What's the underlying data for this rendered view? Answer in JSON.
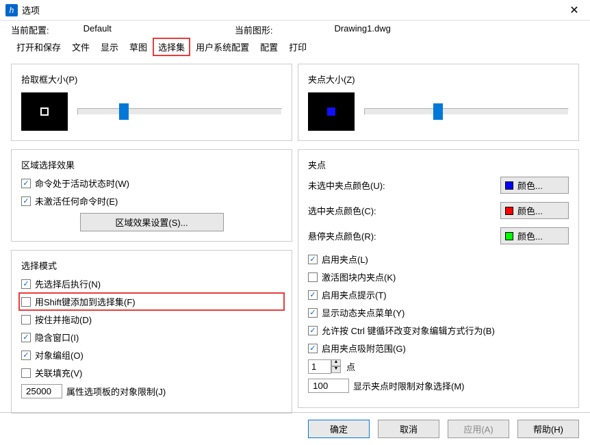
{
  "titlebar": {
    "title": "选项"
  },
  "info": {
    "config_label": "当前配置:",
    "config_value": "Default",
    "drawing_label": "当前图形:",
    "drawing_value": "Drawing1.dwg"
  },
  "tabs": [
    "打开和保存",
    "文件",
    "显示",
    "草图",
    "选择集",
    "用户系统配置",
    "配置",
    "打印"
  ],
  "pickbox": {
    "label": "拾取框大小(P)"
  },
  "gripsize": {
    "label": "夹点大小(Z)"
  },
  "region": {
    "label": "区域选择效果",
    "cb1": "命令处于活动状态时(W)",
    "cb2": "未激活任何命令时(E)",
    "btn": "区域效果设置(S)..."
  },
  "selmode": {
    "label": "选择模式",
    "cb1": "先选择后执行(N)",
    "cb2": "用Shift键添加到选择集(F)",
    "cb3": "按住并拖动(D)",
    "cb4": "隐含窗口(I)",
    "cb5": "对象编组(O)",
    "cb6": "关联填充(V)",
    "num": "25000",
    "num_label": "属性选项板的对象限制(J)"
  },
  "grips": {
    "label": "夹点",
    "row1": "未选中夹点颜色(U):",
    "row2": "选中夹点颜色(C):",
    "row3": "悬停夹点颜色(R):",
    "color_btn": "颜色...",
    "cb1": "启用夹点(L)",
    "cb2": "激活图块内夹点(K)",
    "cb3": "启用夹点提示(T)",
    "cb4": "显示动态夹点菜单(Y)",
    "cb5": "允许按 Ctrl 键循环改变对象编辑方式行为(B)",
    "cb6": "启用夹点吸附范围(G)",
    "spin": "1",
    "spin_label": "点",
    "num": "100",
    "num_label": "显示夹点时限制对象选择(M)"
  },
  "buttons": {
    "ok": "确定",
    "cancel": "取消",
    "apply": "应用(A)",
    "help": "帮助(H)"
  }
}
